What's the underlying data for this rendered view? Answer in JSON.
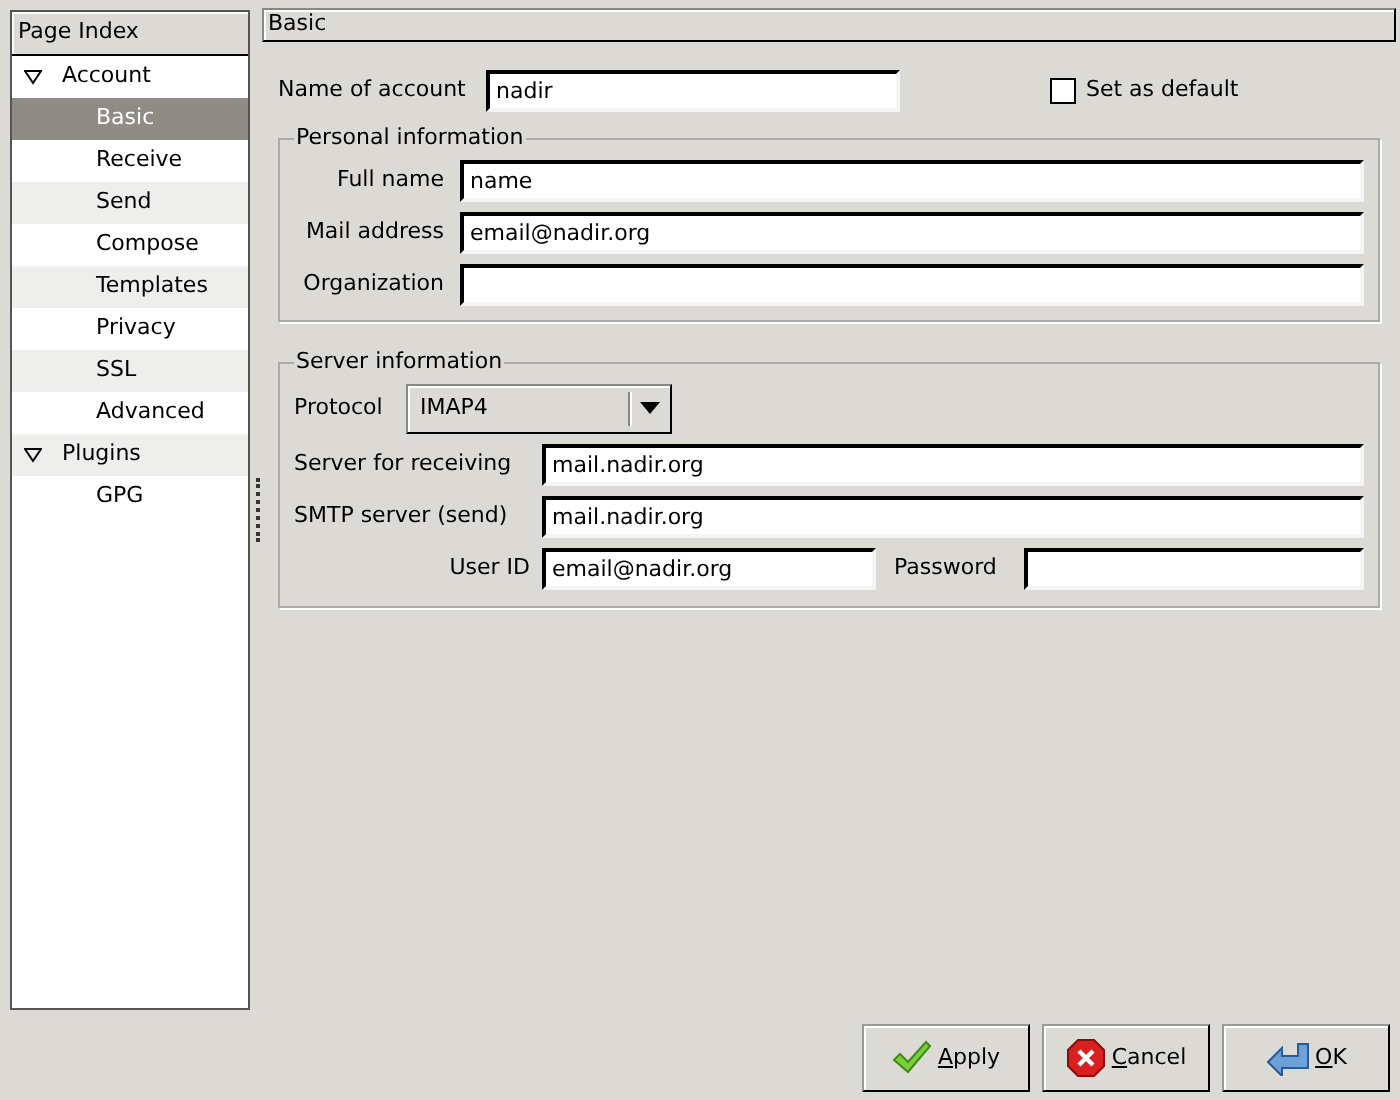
{
  "sidebar": {
    "header": "Page Index",
    "items": [
      {
        "label": "Account",
        "expanded": true,
        "selected": false,
        "children": [
          {
            "label": "Basic",
            "selected": true
          },
          {
            "label": "Receive",
            "selected": false
          },
          {
            "label": "Send",
            "selected": false
          },
          {
            "label": "Compose",
            "selected": false
          },
          {
            "label": "Templates",
            "selected": false
          },
          {
            "label": "Privacy",
            "selected": false
          },
          {
            "label": "SSL",
            "selected": false
          },
          {
            "label": "Advanced",
            "selected": false
          }
        ]
      },
      {
        "label": "Plugins",
        "expanded": true,
        "selected": false,
        "children": [
          {
            "label": "GPG",
            "selected": false
          }
        ]
      }
    ]
  },
  "page_title": "Basic",
  "account_name": {
    "label": "Name of account",
    "value": "nadir"
  },
  "set_as_default": {
    "label": "Set as default",
    "checked": false
  },
  "personal_information": {
    "title": "Personal information",
    "fields": [
      {
        "label": "Full name",
        "value": "name"
      },
      {
        "label": "Mail address",
        "value": "email@nadir.org"
      },
      {
        "label": "Organization"
      }
    ]
  },
  "server_information": {
    "title": "Server information",
    "protocol": {
      "label": "Protocol",
      "value": "IMAP4"
    },
    "fields": [
      {
        "label": "Server for receiving",
        "value": "mail.nadir.org"
      },
      {
        "label": "SMTP server (send)",
        "value": "mail.nadir.org"
      }
    ],
    "user_id": {
      "label": "User ID",
      "value": "email@nadir.org"
    },
    "password": {
      "label": "Password"
    }
  },
  "buttons": [
    {
      "label": "Apply",
      "kind": "apply"
    },
    {
      "label": "Cancel",
      "kind": "cancel"
    },
    {
      "label": "OK",
      "kind": "ok"
    }
  ]
}
